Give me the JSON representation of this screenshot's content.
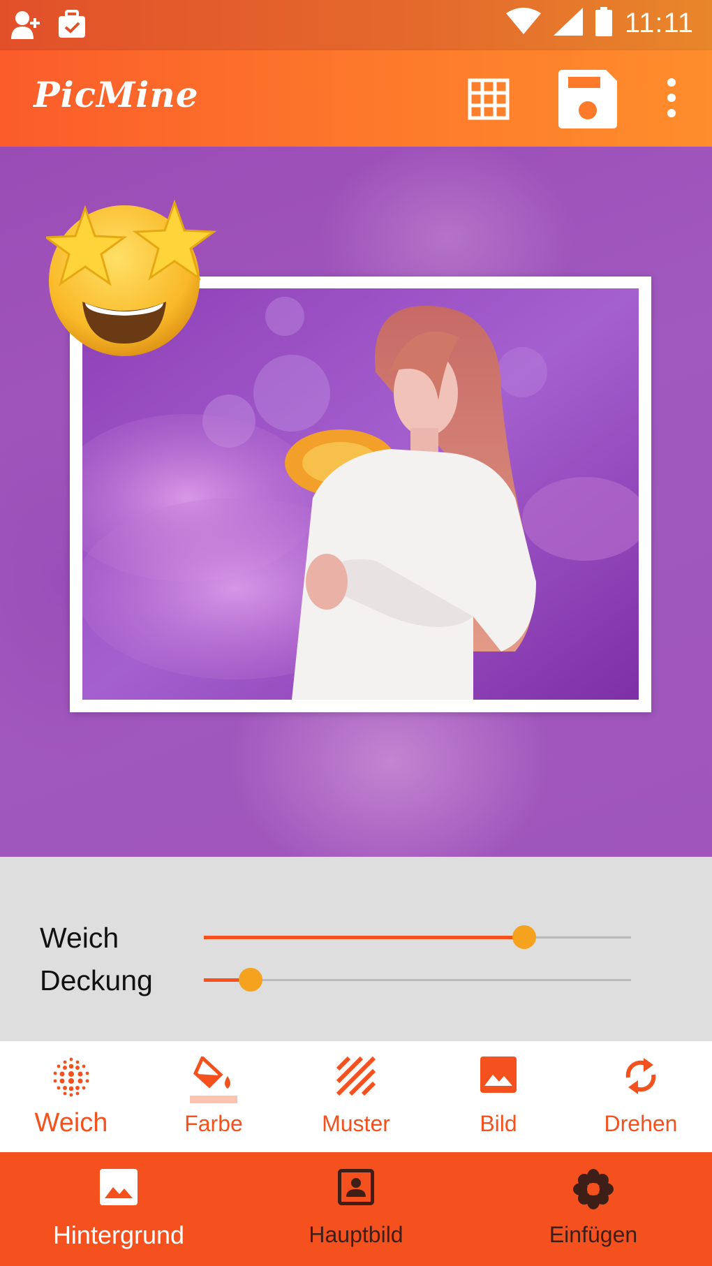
{
  "status_bar": {
    "time": "11:11",
    "icons": [
      "add-contact-icon",
      "briefcase-check-icon",
      "wifi-icon",
      "signal-icon",
      "battery-icon"
    ]
  },
  "app_bar": {
    "title": "PicMine",
    "actions": [
      "grid-icon",
      "save-icon",
      "more-vert-icon"
    ]
  },
  "sliders": [
    {
      "label": "Weich",
      "value": 0.75
    },
    {
      "label": "Deckung",
      "value": 0.11
    }
  ],
  "tools": [
    {
      "label": "Weich",
      "icon": "halftone-dots-icon",
      "selected": true
    },
    {
      "label": "Farbe",
      "icon": "paint-bucket-icon",
      "selected": false
    },
    {
      "label": "Muster",
      "icon": "stripes-pattern-icon",
      "selected": false
    },
    {
      "label": "Bild",
      "icon": "image-icon",
      "selected": false
    },
    {
      "label": "Drehen",
      "icon": "rotate-icon",
      "selected": false
    }
  ],
  "bottom_nav": [
    {
      "label": "Hintergrund",
      "icon": "image-icon",
      "active": true
    },
    {
      "label": "Hauptbild",
      "icon": "portrait-icon",
      "active": false
    },
    {
      "label": "Einfügen",
      "icon": "flower-icon",
      "active": false
    }
  ],
  "colors": {
    "accent": "#f4511e",
    "app_bar_start": "#fb5c2a",
    "app_bar_end": "#ff8d2c",
    "slider_thumb": "#f5a21e",
    "canvas_purple": "#9f55bb"
  }
}
